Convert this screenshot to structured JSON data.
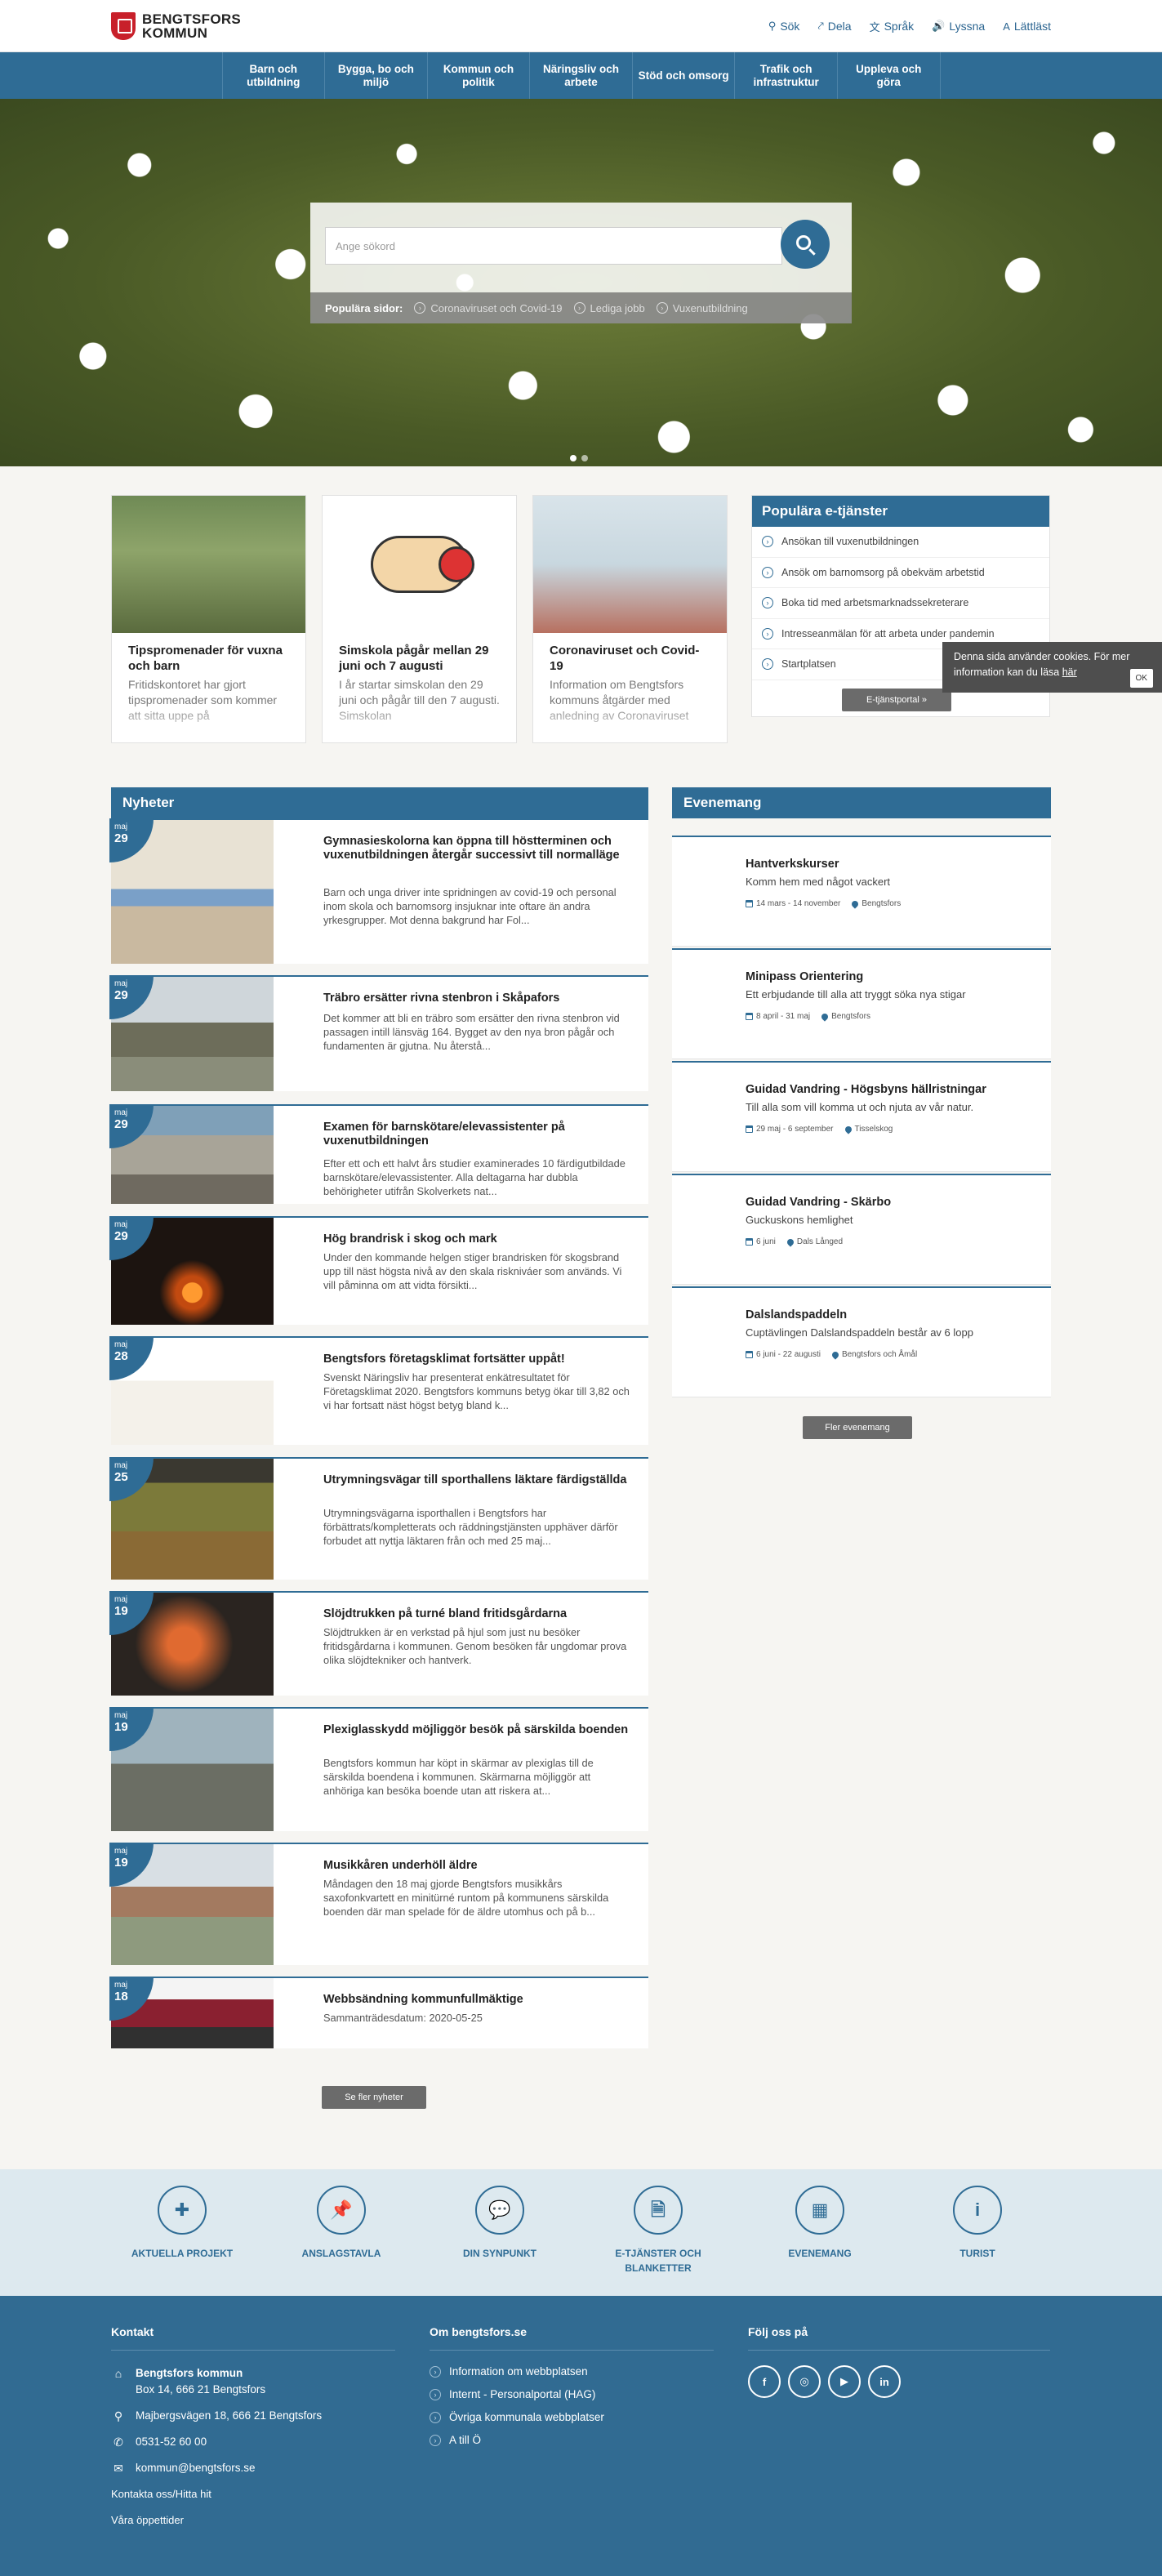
{
  "header": {
    "logo_line1": "BENGTSFORS",
    "logo_line2": "KOMMUN",
    "tools": [
      {
        "label": "Sök",
        "icon": "search-icon",
        "glyph": "⚲"
      },
      {
        "label": "Dela",
        "icon": "share-icon",
        "glyph": "⤤"
      },
      {
        "label": "Språk",
        "icon": "language-icon",
        "glyph": "文"
      },
      {
        "label": "Lyssna",
        "icon": "speaker-icon",
        "glyph": "🔊"
      },
      {
        "label": "Lättläst",
        "icon": "easy-read-icon",
        "glyph": "A"
      }
    ]
  },
  "nav": [
    "Barn och utbildning",
    "Bygga, bo och miljö",
    "Kommun och politik",
    "Näringsliv och arbete",
    "Stöd och omsorg",
    "Trafik och infrastruktur",
    "Uppleva och göra"
  ],
  "hero": {
    "search_placeholder": "Ange sökord",
    "popular_label": "Populära sidor:",
    "popular_links": [
      "Coronaviruset och Covid-19",
      "Lediga jobb",
      "Vuxenutbildning"
    ],
    "slides": 2
  },
  "cards": [
    {
      "title": "Tipspromenader för vuxna och barn",
      "text": "Fritidskontoret har gjort tipspromenader som kommer att sitta uppe på"
    },
    {
      "title": "Simskola pågår mellan 29 juni och 7 augusti",
      "text": "I år startar simskolan den 29 juni och pågår till den 7 augusti. Simskolan"
    },
    {
      "title": "Coronaviruset och Covid-19",
      "text": "Information om Bengtsfors kommuns åtgärder med anledning av Coronaviruset"
    }
  ],
  "eservices": {
    "title": "Populära e-tjänster",
    "items": [
      "Ansökan till vuxenutbildningen",
      "Ansök om barnomsorg på obekväm arbetstid",
      "Boka tid med arbetsmarknadssekreterare",
      "Intresseanmälan för att arbeta under pandemin",
      "Startplatsen"
    ],
    "button": "E-tjänstportal »"
  },
  "cookie": {
    "text": "Denna sida använder cookies. För mer information kan du läsa",
    "link": "här",
    "ok": "OK"
  },
  "news": {
    "title": "Nyheter",
    "items": [
      {
        "month": "maj",
        "day": "29",
        "title": "Gymnasieskolorna kan öppna till höstterminen och vuxenutbildningen återgår successivt till normalläge",
        "text": "Barn och unga driver inte spridningen av covid-19 och personal inom skola och barnomsorg insjuknar inte oftare än andra yrkesgrupper. Mot denna bakgrund har Fol..."
      },
      {
        "month": "maj",
        "day": "29",
        "title": "Träbro ersätter rivna stenbron i Skåpafors",
        "text": "Det kommer att bli en träbro som ersätter den rivna stenbron vid passagen intill länsväg 164. Bygget av den nya bron pågår och fundamenten är gjutna. Nu återstå..."
      },
      {
        "month": "maj",
        "day": "29",
        "title": "Examen för barnskötare/elevassistenter på vuxenutbildningen",
        "text": "Efter ett och ett halvt års studier examinerades 10 färdigutbildade barnskötare/elevassistenter. Alla deltagarna har dubbla behörigheter utifrån Skolverkets nat..."
      },
      {
        "month": "maj",
        "day": "29",
        "title": "Hög brandrisk i skog och mark",
        "text": "Under den kommande helgen stiger brandrisken för skogsbrand upp till näst högsta nivå av den skala riskniváer som används. Vi vill påminna om att vidta försikti..."
      },
      {
        "month": "maj",
        "day": "28",
        "title": "Bengtsfors företagsklimat fortsätter uppåt!",
        "text": "Svenskt Näringsliv har presenterat enkätresultatet för Företagsklimat 2020. Bengtsfors kommuns betyg ökar till 3,82 och vi har fortsatt näst högst betyg bland k..."
      },
      {
        "month": "maj",
        "day": "25",
        "title": "Utrymningsvägar till sporthallens läktare färdigställda",
        "text": "Utrymningsvägarna isporthallen i Bengtsfors har förbättrats/kompletterats och räddningstjänsten upphäver därför forbudet att nyttja läktaren från och med 25 maj..."
      },
      {
        "month": "maj",
        "day": "19",
        "title": "Slöjdtrukken på turné bland fritidsgårdarna",
        "text": "Slöjdtrukken är en verkstad på hjul som just nu besöker fritidsgårdarna i kommunen. Genom besöken får ungdomar prova olika slöjdtekniker och hantverk."
      },
      {
        "month": "maj",
        "day": "19",
        "title": "Plexiglasskydd möjliggör besök på särskilda boenden",
        "text": "Bengtsfors kommun har köpt in skärmar av plexiglas till de särskilda boendena i kommunen. Skärmarna möjliggör att anhöriga kan besöka boende utan att riskera at..."
      },
      {
        "month": "maj",
        "day": "19",
        "title": "Musikkåren underhöll äldre",
        "text": "Måndagen den 18 maj gjorde Bengtsfors musikkårs saxofonkvartett en minitürné runtom på kommunens särskilda boenden där man spelade för de äldre utomhus och på b..."
      },
      {
        "month": "maj",
        "day": "18",
        "title": "Webbsändning kommunfullmäktige",
        "text": "Sammanträdesdatum: 2020-05-25"
      }
    ],
    "more": "Se fler nyheter"
  },
  "events": {
    "title": "Evenemang",
    "items": [
      {
        "title": "Hantverkskurser",
        "sub": "Komm hem med något vackert",
        "date": "14 mars - 14 november",
        "place": "Bengtsfors"
      },
      {
        "title": "Minipass Orientering",
        "sub": "Ett erbjudande till alla att tryggt söka nya stigar",
        "date": "8 april - 31 maj",
        "place": "Bengtsfors"
      },
      {
        "title": "Guidad Vandring - Högsbyns hällristningar",
        "sub": "Till alla som vill komma ut och njuta av vår natur.",
        "date": "29 maj - 6 september",
        "place": "Tisselskog"
      },
      {
        "title": "Guidad Vandring - Skärbo",
        "sub": "Guckuskons hemlighet",
        "date": "6 juni",
        "place": "Dals Långed"
      },
      {
        "title": "Dalslandspaddeln",
        "sub": "Cuptävlingen Dalslandspaddeln består av 6 lopp",
        "date": "6 juni - 22 augusti",
        "place": "Bengtsfors och Åmål"
      }
    ],
    "more": "Fler evenemang"
  },
  "shortcuts": [
    {
      "label": "AKTUELLA PROJEKT",
      "icon": "puzzle-icon",
      "glyph": "✚"
    },
    {
      "label": "ANSLAGSTAVLA",
      "icon": "pin-icon",
      "glyph": "📌"
    },
    {
      "label": "DIN SYNPUNKT",
      "icon": "speech-bubble-icon",
      "glyph": "💬"
    },
    {
      "label": "E-TJÄNSTER OCH BLANKETTER",
      "icon": "document-icon",
      "glyph": "🗎"
    },
    {
      "label": "EVENEMANG",
      "icon": "calendar-icon",
      "glyph": "▦"
    },
    {
      "label": "TURIST",
      "icon": "info-icon",
      "glyph": "i"
    }
  ],
  "footer": {
    "contact_title": "Kontakt",
    "org_name": "Bengtsfors kommun",
    "post_address": "Box 14, 666 21 Bengtsfors",
    "visit_address": "Majbergsvägen 18, 666 21 Bengtsfors",
    "phone": "0531-52 60 00",
    "email": "kommun@bengtsfors.se",
    "contact_link": "Kontakta oss/Hitta hit",
    "hours_link": "Våra öppettider",
    "about_title": "Om bengtsfors.se",
    "about_links": [
      "Information om webbplatsen",
      "Internt - Personalportal (HAG)",
      "Övriga kommunala webbplatser",
      "A till Ö"
    ],
    "follow_title": "Följ oss på",
    "social": [
      {
        "icon": "facebook-icon",
        "glyph": "f"
      },
      {
        "icon": "instagram-icon",
        "glyph": "◎"
      },
      {
        "icon": "youtube-icon",
        "glyph": "▶"
      },
      {
        "icon": "linkedin-icon",
        "glyph": "in"
      }
    ]
  }
}
